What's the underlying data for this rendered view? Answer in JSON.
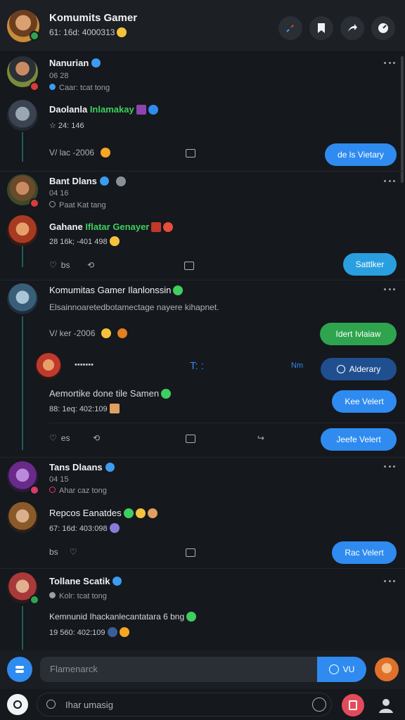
{
  "header": {
    "title": "Komumits Gamer",
    "subtitle": "61: 16d: 4000313"
  },
  "posts": [
    {
      "name": "Nanurian",
      "meta": "06 28",
      "sub": "Caar: tcat tong"
    },
    {
      "name": "Daolanla",
      "highlight": "Inlamakay",
      "meta": "24: 146",
      "action_count": "V/ lac -2006",
      "button": "de ls Vietary"
    },
    {
      "name": "Bant Dlans",
      "meta": "04 16",
      "sub": "Paat Kat tang"
    },
    {
      "name": "Gahane",
      "highlight": "Iflatar Genayer",
      "meta": "28 16k; -401 498",
      "action_count": "bs",
      "button": "Sattlker"
    },
    {
      "name": "Komumitas Gamer Ilanlonssin",
      "body": "Elsainnoaretedbotamectage nayere kihapnet.",
      "action_count": "V/ ker -2006",
      "button": "Idert Ivlaiaw"
    },
    {
      "reply_meta": "•••••••",
      "reply_mid": "T: :",
      "reply_right": "Nm",
      "reply_button": "Alderary",
      "name": "Aemortike done tile Samen",
      "meta": "88: 1eq: 402:109",
      "button": "Kee Velert",
      "action_count": "es",
      "button2": "Jeefe Velert"
    },
    {
      "name": "Tans Dlaans",
      "meta": "04 15",
      "sub": "Ahar caz tong"
    },
    {
      "name": "Repcos Eanatdes",
      "meta": "67: 16d: 403:098",
      "action_count": "bs",
      "button": "Rac Velert"
    },
    {
      "name": "Tollane Scatik",
      "sub": "Kolr: tcat tong",
      "body": "Kemnunid Ihackanlecantatara 6 bng",
      "meta": "19 560: 402:109"
    }
  ],
  "composer": {
    "placeholder": "Flamenarck",
    "send_label": "VU"
  },
  "bottombar": {
    "search_placeholder": "Ihar umasig"
  },
  "colors": {
    "accent": "#2f8bf0",
    "green": "#2ea44f",
    "thread": "#1f5c5a",
    "background": "#15181d"
  }
}
